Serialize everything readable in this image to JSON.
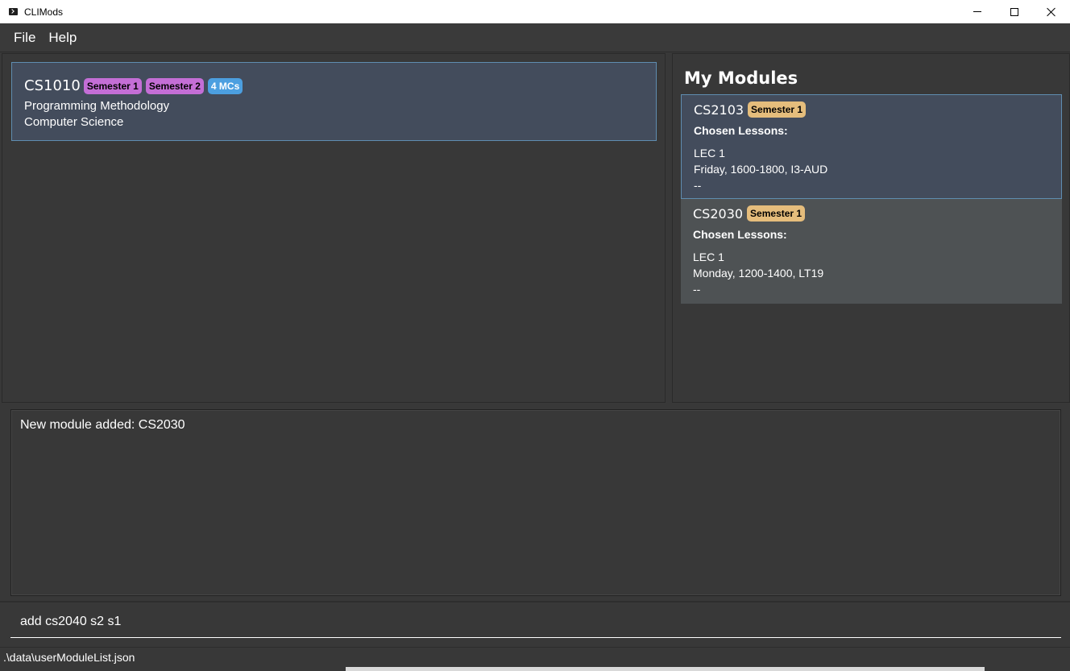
{
  "window": {
    "title": "CLIMods"
  },
  "menu": {
    "file": "File",
    "help": "Help"
  },
  "search_results": [
    {
      "code": "CS1010",
      "semesters": [
        "Semester 1",
        "Semester 2"
      ],
      "mcs": "4 MCs",
      "title": "Programming Methodology",
      "department": "Computer Science"
    }
  ],
  "my_modules": {
    "heading": "My Modules",
    "chosen_label": "Chosen Lessons:",
    "items": [
      {
        "code": "CS2103",
        "semester": "Semester 1",
        "lesson": "LEC 1",
        "detail": "Friday, 1600-1800, I3-AUD",
        "separator": "--"
      },
      {
        "code": "CS2030",
        "semester": "Semester 1",
        "lesson": "LEC 1",
        "detail": "Monday, 1200-1400, LT19",
        "separator": "--"
      }
    ]
  },
  "result": {
    "message": "New module added: CS2030"
  },
  "command": {
    "value": "add cs2040 s2 s1"
  },
  "status": {
    "file_path": ".\\data\\userModuleList.json"
  },
  "colors": {
    "background": "#383838",
    "selected_card": "#434c5c",
    "semester_badge": "#c46ed6",
    "mc_badge": "#4c9fe0",
    "chosen_semester_badge": "#e5bd7c"
  }
}
